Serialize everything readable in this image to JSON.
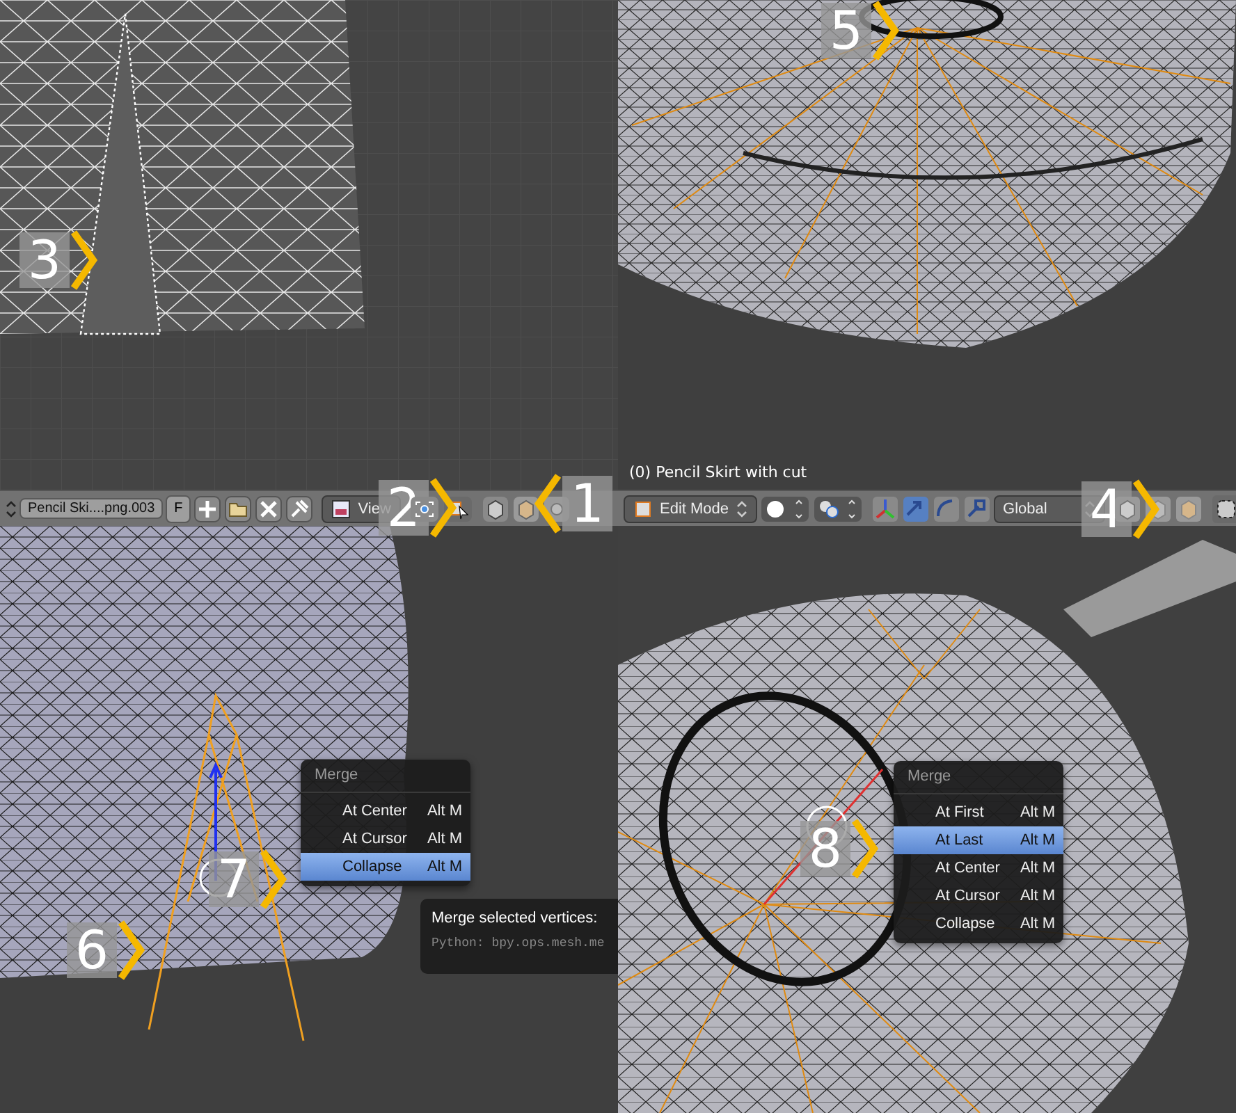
{
  "uv_editor": {
    "header": {
      "image_name": "Pencil Ski....png.003",
      "fake_user": "F",
      "view_menu": "View"
    }
  },
  "viewport_3d": {
    "object_label": "(0) Pencil Skirt with cut",
    "header": {
      "mode": "Edit Mode",
      "orientation": "Global",
      "transform_tools": [
        {
          "kind": "translate",
          "selected": true
        },
        {
          "kind": "rotate",
          "selected": false
        },
        {
          "kind": "scale",
          "selected": false
        }
      ]
    }
  },
  "merge_menus": [
    {
      "title": "Merge",
      "items": [
        {
          "label": "At Center",
          "shortcut": "Alt M",
          "selected": false
        },
        {
          "label": "At Cursor",
          "shortcut": "Alt M",
          "selected": false
        },
        {
          "label": "Collapse",
          "shortcut": "Alt M",
          "selected": true
        }
      ]
    },
    {
      "title": "Merge",
      "items": [
        {
          "label": "At First",
          "shortcut": "Alt M",
          "selected": false
        },
        {
          "label": "At Last",
          "shortcut": "Alt M",
          "selected": true
        },
        {
          "label": "At Center",
          "shortcut": "Alt M",
          "selected": false
        },
        {
          "label": "At Cursor",
          "shortcut": "Alt M",
          "selected": false
        },
        {
          "label": "Collapse",
          "shortcut": "Alt M",
          "selected": false
        }
      ]
    }
  ],
  "tooltip": {
    "title": "Merge selected vertices:",
    "python": "Python: bpy.ops.mesh.me"
  },
  "callouts": [
    {
      "number": "5"
    },
    {
      "number": "3"
    },
    {
      "number": "2"
    },
    {
      "number": "1"
    },
    {
      "number": "4"
    },
    {
      "number": "7"
    },
    {
      "number": "8"
    },
    {
      "number": "6"
    }
  ]
}
